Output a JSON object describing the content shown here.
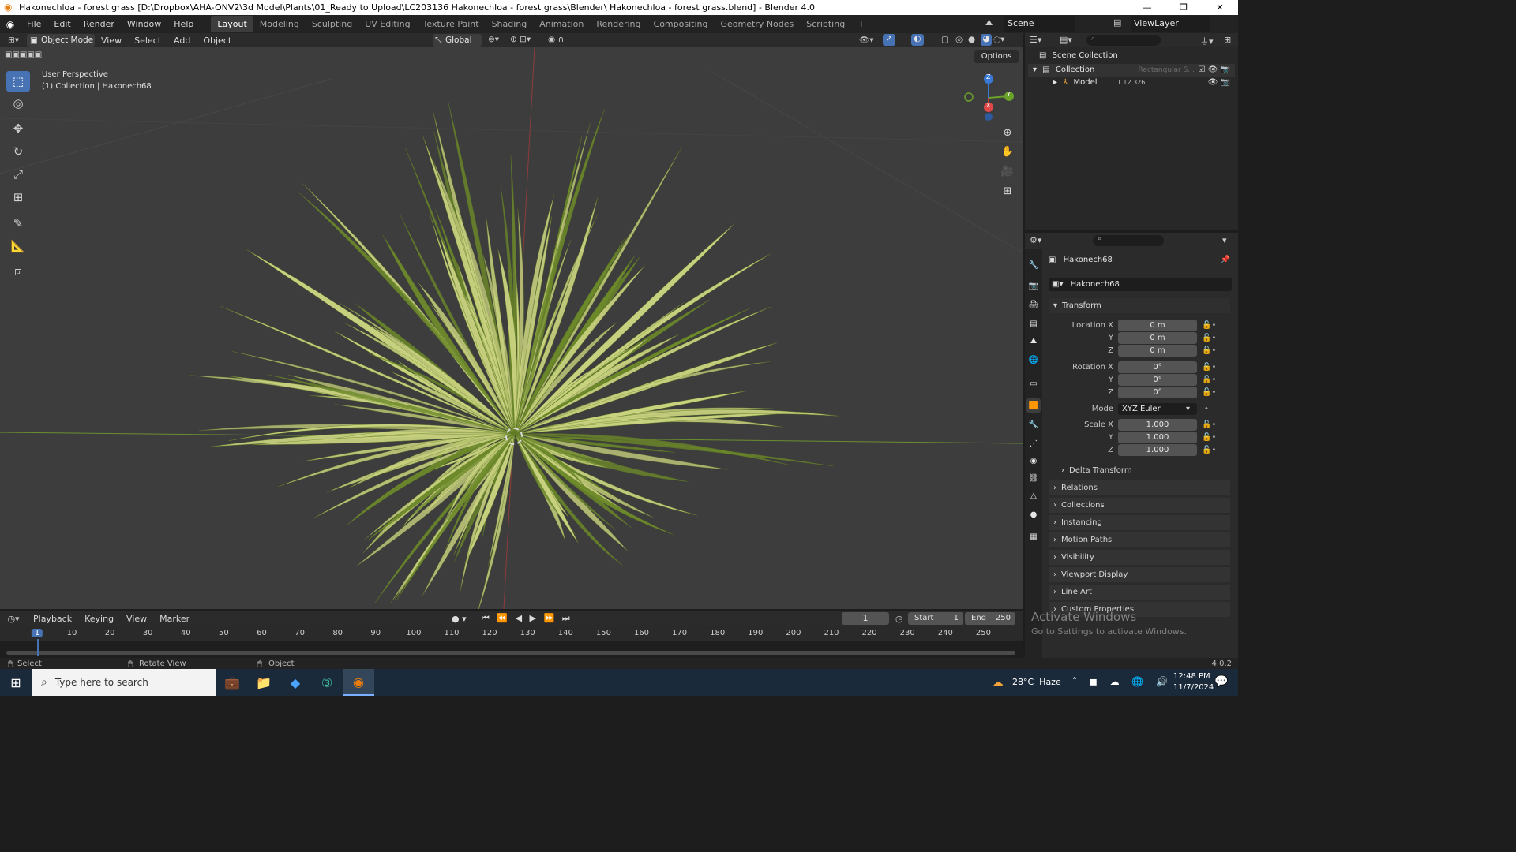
{
  "window": {
    "title": "Hakonechloa - forest grass [D:\\Dropbox\\AHA-ONV2\\3d Model\\Plants\\01_Ready to Upload\\LC203136 Hakonechloa - forest grass\\Blender\\ Hakonechloa - forest grass.blend] - Blender 4.0",
    "minimize": "—",
    "restore": "❐",
    "close": "✕"
  },
  "menu": [
    "File",
    "Edit",
    "Render",
    "Window",
    "Help"
  ],
  "workspaces": [
    "Layout",
    "Modeling",
    "Sculpting",
    "UV Editing",
    "Texture Paint",
    "Shading",
    "Animation",
    "Rendering",
    "Compositing",
    "Geometry Nodes",
    "Scripting"
  ],
  "add_workspace": "+",
  "scene": {
    "label": "Scene",
    "view_layer": "ViewLayer"
  },
  "viewport_header": {
    "mode": "Object Mode",
    "menus": [
      "View",
      "Select",
      "Add",
      "Object"
    ],
    "orientation": "Global",
    "options": "Options"
  },
  "viewport": {
    "perspective": "User Perspective",
    "collection_info": "(1) Collection | Hakonech68",
    "gizmo": {
      "z": "Z",
      "y": "Y",
      "x": "X"
    }
  },
  "outliner": {
    "search_placeholder": "",
    "items": [
      {
        "label": "Scene Collection"
      },
      {
        "label": "Collection",
        "extra": "Rectangular S..."
      },
      {
        "label": "Model",
        "extra": "1.12.326"
      }
    ]
  },
  "properties": {
    "object_name": "Hakonech68",
    "data_name": "Hakonech68",
    "transform_title": "Transform",
    "fields": [
      {
        "label": "Location X",
        "value": "0 m"
      },
      {
        "label": "Y",
        "value": "0 m"
      },
      {
        "label": "Z",
        "value": "0 m"
      },
      {
        "label": "Rotation X",
        "value": "0°"
      },
      {
        "label": "Y",
        "value": "0°"
      },
      {
        "label": "Z",
        "value": "0°"
      },
      {
        "label": "Mode",
        "value": "XYZ Euler"
      },
      {
        "label": "Scale X",
        "value": "1.000"
      },
      {
        "label": "Y",
        "value": "1.000"
      },
      {
        "label": "Z",
        "value": "1.000"
      }
    ],
    "panels": [
      "Delta Transform",
      "Relations",
      "Collections",
      "Instancing",
      "Motion Paths",
      "Visibility",
      "Viewport Display",
      "Line Art",
      "Custom Properties"
    ]
  },
  "timeline": {
    "menus": [
      "Playback",
      "Keying",
      "View",
      "Marker"
    ],
    "current_frame": "1",
    "start_label": "Start",
    "start": "1",
    "end_label": "End",
    "end": "250",
    "ticks": [
      "1",
      "10",
      "20",
      "30",
      "40",
      "50",
      "60",
      "70",
      "80",
      "90",
      "100",
      "110",
      "120",
      "130",
      "140",
      "150",
      "160",
      "170",
      "180",
      "190",
      "200",
      "210",
      "220",
      "230",
      "240",
      "250"
    ]
  },
  "status": {
    "select": "Select",
    "rotate": "Rotate View",
    "object": "Object",
    "version": "4.0.2",
    "activate_title": "Activate Windows",
    "activate_sub": "Go to Settings to activate Windows."
  },
  "taskbar": {
    "search_placeholder": "Type here to search",
    "weather": "28°C  Haze",
    "time": "12:48 PM",
    "date": "11/7/2024"
  },
  "colors": {
    "accent": "#4772b3",
    "grass_light": "#c9d27f",
    "grass_dark": "#6d8a2a"
  }
}
